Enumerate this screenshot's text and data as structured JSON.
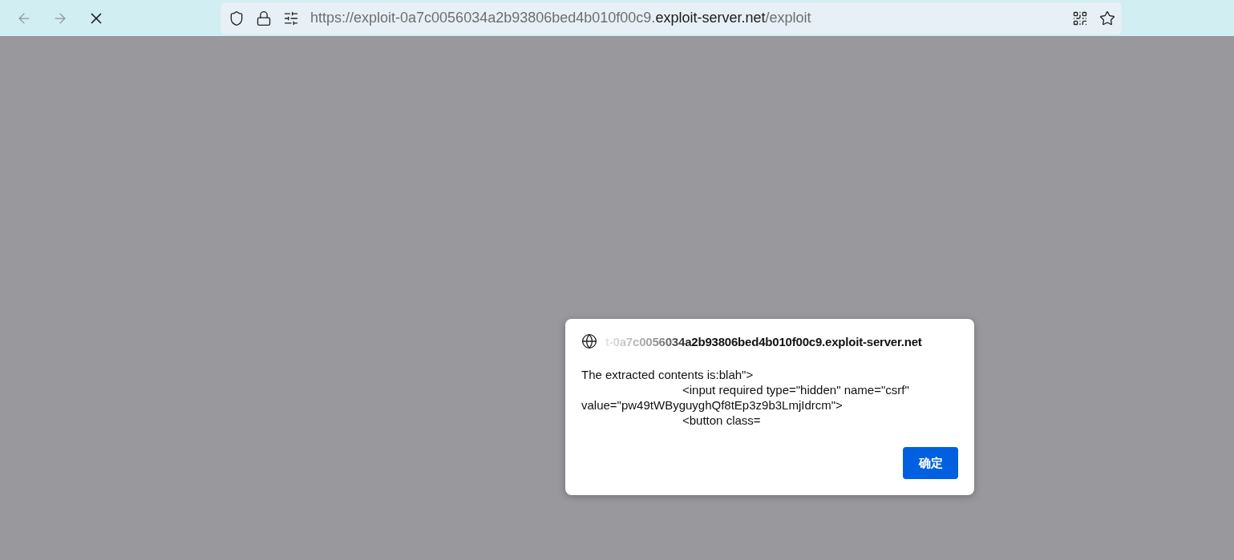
{
  "toolbar": {
    "back": {
      "disabled": true
    },
    "forward": {
      "disabled": true
    },
    "loading": true
  },
  "address_bar": {
    "prefix": "https://exploit-0a7c0056034a2b93806bed4b010f00c9.",
    "domain": "exploit-server.net",
    "path": "/exploit"
  },
  "dialog": {
    "origin": "t-0a7c0056034a2b93806bed4b010f00c9.exploit-server.net",
    "lines": [
      {
        "text": "The extracted contents is:blah\">",
        "indented": false
      },
      {
        "text": "<input required type=\"hidden\" name=\"csrf\"",
        "indented": true
      },
      {
        "text": "value=\"pw49tWByguyghQf8tEp3z9b3LmjIdrcm\">",
        "indented": false
      },
      {
        "text": "<button class=",
        "indented": true
      }
    ],
    "button": "确定"
  }
}
